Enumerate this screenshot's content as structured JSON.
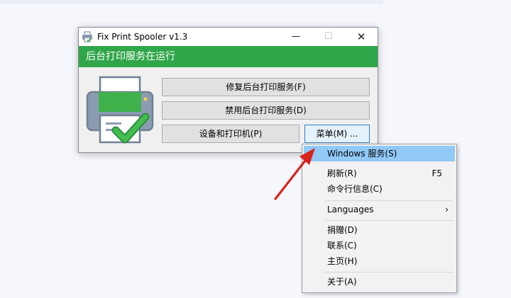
{
  "window": {
    "title": "Fix Print Spooler v1.3",
    "controls": {
      "minimize": "—",
      "maximize": "☐",
      "close": "✕"
    },
    "banner": "后台打印服务在运行",
    "accent_color": "#30a64a"
  },
  "buttons": {
    "repair": "修复后台打印服务(F)",
    "disable": "禁用后台打印服务(D)",
    "devices": "设备和打印机(P)",
    "menu": "菜单(M) ..."
  },
  "context_menu": {
    "items": [
      {
        "label": "Windows 服务(S)",
        "shortcut": "",
        "highlighted": true
      },
      {
        "label": "刷新(R)",
        "shortcut": "F5"
      },
      {
        "label": "命令行信息(C)",
        "shortcut": ""
      },
      {
        "label": "Languages",
        "shortcut": "",
        "submenu": true
      },
      {
        "label": "捐赠(D)",
        "shortcut": ""
      },
      {
        "label": "联系(C)",
        "shortcut": ""
      },
      {
        "label": "主页(H)",
        "shortcut": ""
      },
      {
        "label": "关于(A)",
        "shortcut": ""
      }
    ],
    "submenu_glyph": "›",
    "highlight_color": "#91c9f7"
  },
  "annotation": {
    "arrow_color": "#d9221c"
  }
}
